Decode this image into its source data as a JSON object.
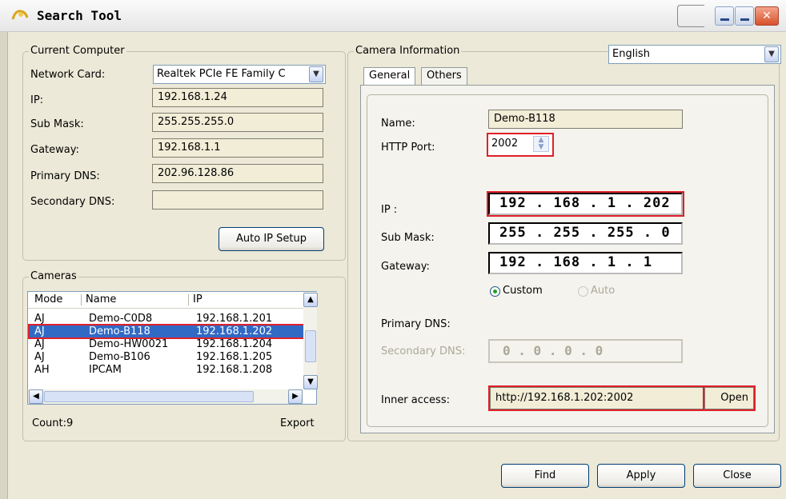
{
  "window": {
    "title": "Search Tool",
    "close_glyph": "✕"
  },
  "current_computer": {
    "legend": "Current Computer",
    "network_card_label": "Network Card:",
    "network_card_value": "Realtek PCIe FE Family C",
    "ip_label": "IP:",
    "ip_value": "192.168.1.24",
    "submask_label": "Sub Mask:",
    "submask_value": "255.255.255.0",
    "gateway_label": "Gateway:",
    "gateway_value": "192.168.1.1",
    "primary_dns_label": "Primary DNS:",
    "primary_dns_value": "202.96.128.86",
    "secondary_dns_label": "Secondary DNS:",
    "secondary_dns_value": "",
    "auto_ip_button": "Auto IP Setup"
  },
  "cameras": {
    "legend": "Cameras",
    "columns": [
      "Mode",
      "Name",
      "IP"
    ],
    "rows": [
      {
        "mode": "AJ",
        "name": "Demo-C0D8",
        "ip": "192.168.1.201"
      },
      {
        "mode": "AJ",
        "name": "Demo-B118",
        "ip": "192.168.1.202"
      },
      {
        "mode": "AJ",
        "name": "Demo-HW0021",
        "ip": "192.168.1.204"
      },
      {
        "mode": "AJ",
        "name": "Demo-B106",
        "ip": "192.168.1.205"
      },
      {
        "mode": "AH",
        "name": "IPCAM",
        "ip": "192.168.1.208"
      }
    ],
    "selected_row": 1,
    "count_label": "Count:9",
    "export_label": "Export"
  },
  "camera_info": {
    "legend": "Camera Information",
    "language": "English",
    "tabs": [
      "General",
      "Others"
    ],
    "name_label": "Name:",
    "name_value": "Demo-B118",
    "http_port_label": "HTTP Port:",
    "http_port_value": "2002",
    "ip_label": "IP :",
    "ip_octets": [
      "192",
      "168",
      "1",
      "202"
    ],
    "submask_label": "Sub Mask:",
    "submask_octets": [
      "255",
      "255",
      "255",
      "0"
    ],
    "gateway_label": "Gateway:",
    "gateway_octets": [
      "192",
      "168",
      "1",
      "1"
    ],
    "custom_label": "Custom",
    "auto_label": "Auto",
    "primary_dns_label": "Primary DNS:",
    "secondary_dns_label": "Secondary DNS:",
    "secondary_dns_octets": [
      "0",
      "0",
      "0",
      "0"
    ],
    "inner_access_label": "Inner access:",
    "inner_access_value": "http://192.168.1.202:2002",
    "open_button": "Open"
  },
  "footer": {
    "find": "Find",
    "apply": "Apply",
    "close": "Close"
  }
}
